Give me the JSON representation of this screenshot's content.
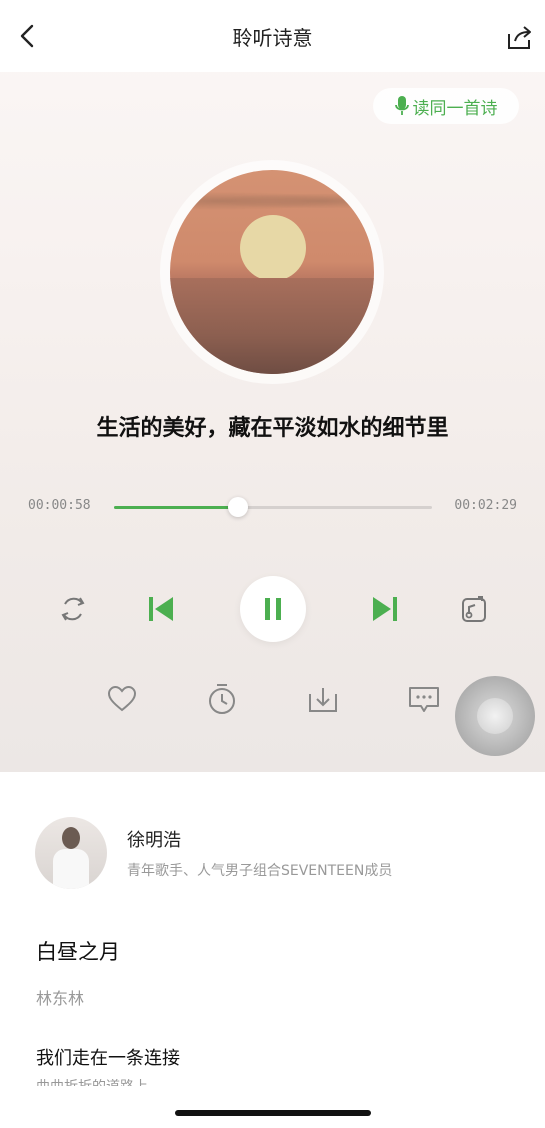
{
  "header": {
    "title": "聆听诗意",
    "back_icon": "back-chevron-icon",
    "share_icon": "share-icon"
  },
  "read_button": {
    "label": "读同一首诗",
    "icon": "microphone-icon",
    "color": "#4caf50"
  },
  "lyric": "生活的美好，藏在平淡如水的细节里",
  "player": {
    "elapsed": "00:00:58",
    "total": "00:02:29",
    "progress": 0.39,
    "accent": "#4caf50",
    "controls": [
      "repeat-icon",
      "previous-icon",
      "pause-icon",
      "next-icon",
      "playlist-icon"
    ],
    "actions": [
      "heart-icon",
      "timer-icon",
      "download-icon",
      "comment-icon"
    ]
  },
  "artist": {
    "name": "徐明浩",
    "description": "青年歌手、人气男子组合SEVENTEEN成员"
  },
  "poem": {
    "title": "白昼之月",
    "author": "林东林",
    "first_line": "我们走在一条连接",
    "second_line": "曲曲折折的道路上"
  }
}
